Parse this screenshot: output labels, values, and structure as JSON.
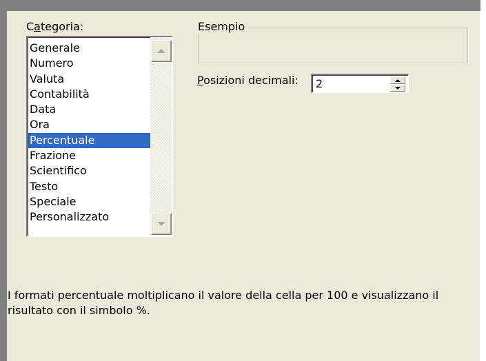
{
  "category": {
    "label_prefix": "C",
    "label_mnemonic": "a",
    "label_rest": "tegoria:",
    "items": [
      "Generale",
      "Numero",
      "Valuta",
      "Contabilità",
      "Data",
      "Ora",
      "Percentuale",
      "Frazione",
      "Scientifico",
      "Testo",
      "Speciale",
      "Personalizzato"
    ],
    "selected": "Percentuale"
  },
  "sample": {
    "label": "Esempio",
    "value": ""
  },
  "decimals": {
    "label_mnemonic": "P",
    "label_rest": "osizioni decimali:",
    "value": "2"
  },
  "description": "I formati percentuale moltiplicano il valore della cella per 100 e visualizzano il risultato con il simbolo %.",
  "colors": {
    "selection": "#316ac5",
    "dialog_background": "#ece9d8",
    "frame_gray": "#808080"
  }
}
